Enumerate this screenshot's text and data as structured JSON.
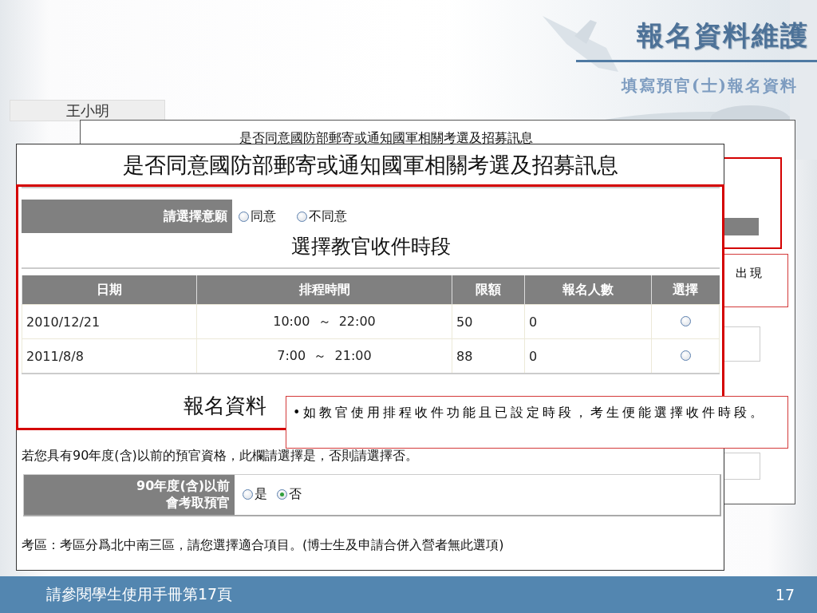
{
  "slide": {
    "title": "報名資料維護",
    "subtitle": "填寫預官(士)報名資料",
    "footer_text": "請參閱學生使用手冊第17頁",
    "page_number": "17"
  },
  "back_window": {
    "tab": "王小明",
    "title": "是否同意國防部郵寄或通知國軍相關考選及招募訊息"
  },
  "callouts": [
    {
      "text": "出現"
    },
    {
      "text": "•如教官使用排程收件功能且已設定時段，考生便能選擇收件時段。"
    }
  ],
  "form": {
    "title": "是否同意國防部郵寄或通知國軍相關考選及招募訊息",
    "consent": {
      "label": "請選擇意願",
      "options": [
        {
          "label": "同意",
          "selected": false
        },
        {
          "label": "不同意",
          "selected": false
        }
      ]
    },
    "schedule": {
      "title": "選擇教官收件時段",
      "columns": [
        "日期",
        "排程時間",
        "限額",
        "報名人數",
        "選擇"
      ],
      "rows": [
        {
          "date": "2010/12/21",
          "time": "10:00  ～  22:00",
          "quota": "50",
          "count": "0",
          "selected": false
        },
        {
          "date": "2011/8/8",
          "time": "7:00  ～  21:00",
          "quota": "88",
          "count": "0",
          "selected": false
        }
      ]
    },
    "section_title": "報名資料",
    "note": "若您具有90年度(含)以前的預官資格，此欄請選擇是，否則請選擇否。",
    "officer": {
      "label_lines": [
        "90年度(含)以前",
        "會考取預官"
      ],
      "options": [
        {
          "label": "是",
          "selected": false
        },
        {
          "label": "否",
          "selected": true
        }
      ]
    },
    "region_note": "考區：考區分爲北中南三區，請您選擇適合項目。(博士生及申請合併入營者無此選項)"
  }
}
